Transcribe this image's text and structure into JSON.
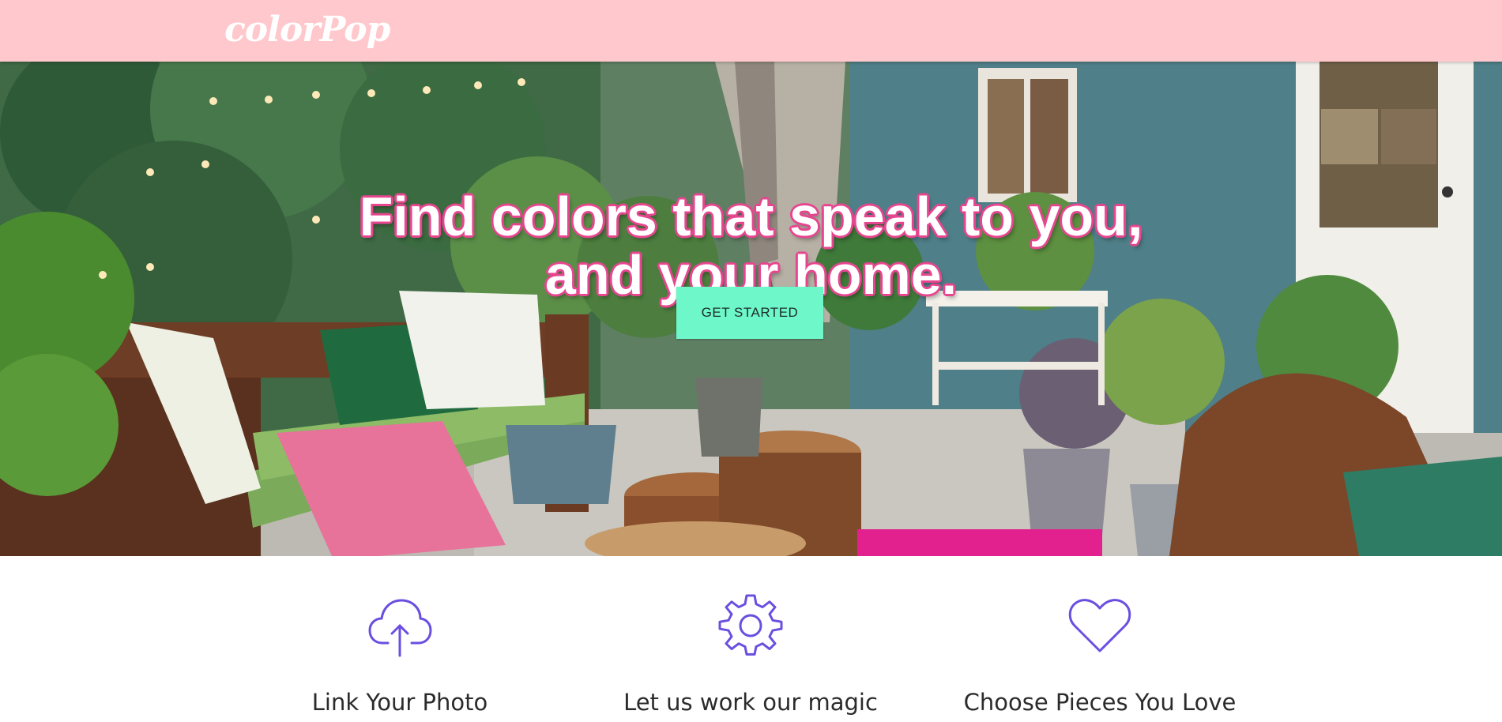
{
  "brand": {
    "logo": "colorPop"
  },
  "colors": {
    "navbar_bg": "#ffc8cc",
    "cta_bg": "#6ef7c9",
    "title_outline": "#e6468f",
    "icon_stroke": "#6a4fe0"
  },
  "hero": {
    "title_line1": "Find colors that speak to you,",
    "title_line2": "and your home.",
    "cta_label": "GET STARTED"
  },
  "features": [
    {
      "icon": "cloud-upload-icon",
      "label": "Link Your Photo"
    },
    {
      "icon": "gear-icon",
      "label": "Let us work our magic"
    },
    {
      "icon": "heart-icon",
      "label": "Choose Pieces You Love"
    }
  ]
}
